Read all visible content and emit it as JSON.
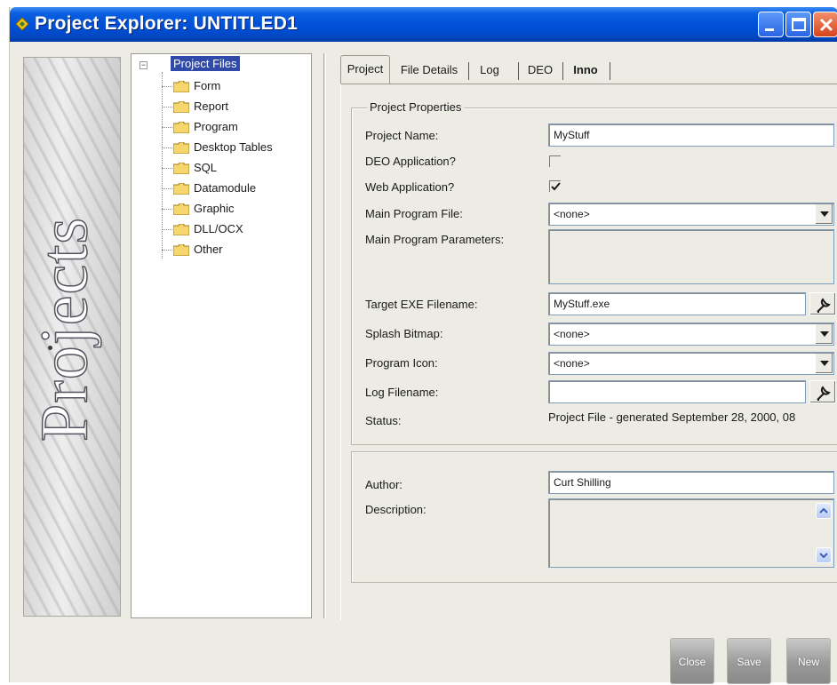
{
  "window": {
    "title": "Project Explorer: UNTITLED1"
  },
  "banner": {
    "text": "Projects"
  },
  "tree": {
    "root": "Project Files",
    "items": [
      {
        "label": "Form"
      },
      {
        "label": "Report"
      },
      {
        "label": "Program"
      },
      {
        "label": "Desktop Tables"
      },
      {
        "label": "SQL"
      },
      {
        "label": "Datamodule"
      },
      {
        "label": "Graphic"
      },
      {
        "label": "DLL/OCX"
      },
      {
        "label": "Other"
      }
    ]
  },
  "tabs": [
    {
      "label": "Project",
      "active": true
    },
    {
      "label": "File Details",
      "active": false
    },
    {
      "label": "Log",
      "active": false
    },
    {
      "label": "DEO",
      "active": false
    },
    {
      "label": "Inno",
      "active": false
    }
  ],
  "project_properties": {
    "legend": "Project Properties",
    "project_name": {
      "label": "Project Name:",
      "value": "MyStuff"
    },
    "deo_application": {
      "label": "DEO Application?",
      "checked": false
    },
    "web_application": {
      "label": "Web Application?",
      "checked": true
    },
    "main_program_file": {
      "label": "Main Program File:",
      "value": "<none>"
    },
    "main_program_parameters": {
      "label": "Main Program Parameters:",
      "value": ""
    },
    "target_exe_filename": {
      "label": "Target EXE Filename:",
      "value": "MyStuff.exe"
    },
    "splash_bitmap": {
      "label": "Splash Bitmap:",
      "value": "<none>"
    },
    "program_icon": {
      "label": "Program Icon:",
      "value": "<none>"
    },
    "log_filename": {
      "label": "Log Filename:",
      "value": ""
    },
    "status": {
      "label": "Status:",
      "value": "Project File - generated September 28, 2000, 08"
    }
  },
  "author_section": {
    "author": {
      "label": "Author:",
      "value": "Curt Shilling"
    },
    "description": {
      "label": "Description:",
      "value": ""
    }
  },
  "buttons": {
    "close": "Close",
    "save": "Save",
    "new": "New"
  },
  "colors": {
    "titlebar": "#0050d8",
    "selection": "#2f4aa8",
    "face": "#ecebe4"
  }
}
